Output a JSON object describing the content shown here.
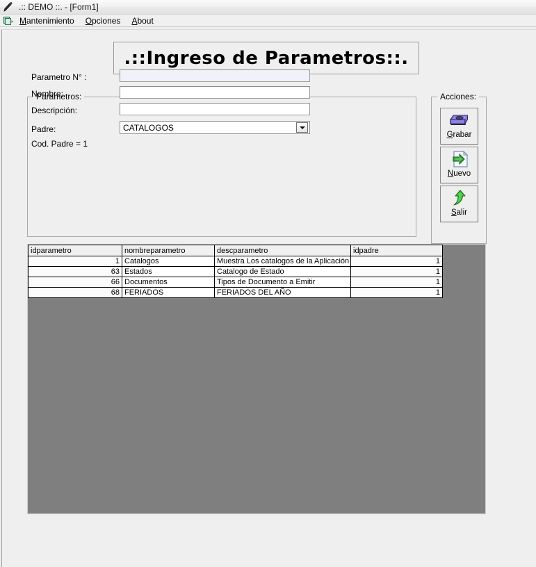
{
  "window": {
    "title": ".:: DEMO ::.  - [Form1]",
    "app_icon": "pen-tool-icon",
    "mdi_icon": "mdi-child-icon"
  },
  "menubar": {
    "items": [
      {
        "name": "menu-mantenimiento",
        "accel": "M",
        "rest": "antenimiento"
      },
      {
        "name": "menu-opciones",
        "accel": "O",
        "rest": "pciones"
      },
      {
        "name": "menu-about",
        "accel": "A",
        "rest": "bout"
      }
    ]
  },
  "heading": {
    "text": ".::Ingreso  de  Parametros::."
  },
  "parametros_group": {
    "legend": "Parametros:",
    "fields": [
      {
        "label": "Parametro N° :",
        "value": "",
        "placeholder": ""
      },
      {
        "label": "Nombre:",
        "value": "",
        "placeholder": ""
      },
      {
        "label": "Descripción:",
        "value": "",
        "placeholder": ""
      }
    ],
    "padre_label": "Padre:",
    "padre_value": "CATALOGOS",
    "padre_options": [
      "CATALOGOS"
    ],
    "cod_padre_text": "Cod. Padre = 1"
  },
  "acciones_group": {
    "legend": "Acciones:",
    "buttons": [
      {
        "name": "grabar-button",
        "accel": "G",
        "rest": "rabar",
        "icon": "floppy-disk-icon"
      },
      {
        "name": "nuevo-button",
        "accel": "N",
        "rest": "uevo",
        "icon": "new-page-arrow-icon"
      },
      {
        "name": "salir-button",
        "accel": "S",
        "rest": "alir",
        "icon": "exit-arrow-icon"
      }
    ]
  },
  "grid": {
    "columns": [
      "idparametro",
      "nombreparametro",
      "descparametro",
      "idpadre"
    ],
    "rows": [
      {
        "idparametro": "1",
        "nombreparametro": "Catalogos",
        "descparametro": "Muestra  Los catalogos de la Aplicación",
        "idpadre": "1"
      },
      {
        "idparametro": "63",
        "nombreparametro": "Estados",
        "descparametro": "Catalogo de Estado",
        "idpadre": "1"
      },
      {
        "idparametro": "66",
        "nombreparametro": "Documentos",
        "descparametro": "Tipos de Documento a Emitir",
        "idpadre": "1"
      },
      {
        "idparametro": "68",
        "nombreparametro": "FERIADOS",
        "descparametro": "FERIADOS DEL AÑO",
        "idpadre": "1"
      }
    ]
  },
  "colors": {
    "form_background": "#efefef",
    "grid_background": "#7f7f7f",
    "grid_header": "#f0f0f0",
    "save_icon": "#6f63c8",
    "new_arrow": "#3d9b3d",
    "exit_arrow": "#33b233"
  }
}
